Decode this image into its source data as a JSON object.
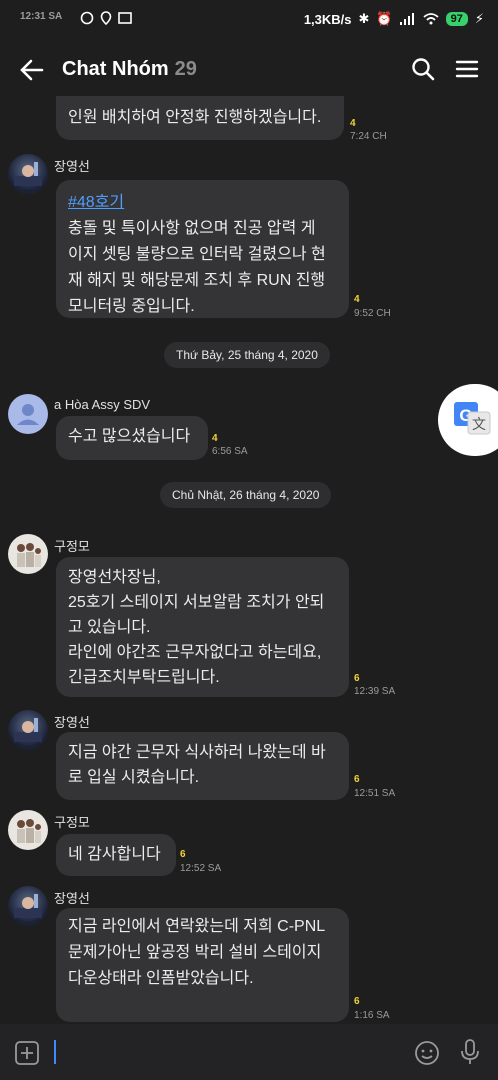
{
  "status_bar": {
    "time": "12:31 SA",
    "network_speed": "1,3KB/s",
    "battery": "97"
  },
  "header": {
    "title": "Chat Nhóm",
    "member_count": "29"
  },
  "messages": [
    {
      "lines": [
        "인원 배치하여 안정화 진행하겠습니다."
      ],
      "read": "4",
      "time": "7:24 CH"
    },
    {
      "sender": "장영선",
      "hashtag": "#48호기",
      "lines": [
        "충돌 및 특이사항 없으며 진공 압력 게",
        "이지 셋팅 불량으로 인터락 걸렸으나 현",
        "재 해지 및 해당문제 조치 후 RUN 진행",
        "모니터링 중입니다."
      ],
      "read": "4",
      "time": "9:52 CH"
    },
    {
      "date": "Thứ Bảy, 25 tháng 4, 2020"
    },
    {
      "sender": "a Hòa Assy SDV",
      "lines": [
        "수고 많으셨습니다"
      ],
      "read": "4",
      "time": "6:56 SA"
    },
    {
      "date": "Chủ Nhật, 26 tháng 4, 2020"
    },
    {
      "sender": "구정모",
      "lines": [
        "장영선차장님,",
        "25호기 스테이지 서보알람 조치가 안되",
        "고 있습니다.",
        "라인에 야간조 근무자없다고 하는데요,",
        "긴급조치부탁드립니다."
      ],
      "read": "6",
      "time": "12:39 SA"
    },
    {
      "sender": "장영선",
      "lines": [
        "지금 야간 근무자 식사하러 나왔는데 바",
        "로 입실 시켰습니다."
      ],
      "read": "6",
      "time": "12:51 SA"
    },
    {
      "sender": "구정모",
      "lines": [
        "네 감사합니다"
      ],
      "read": "6",
      "time": "12:52 SA"
    },
    {
      "sender": "장영선",
      "lines": [
        "지금 라인에서 연락왔는데 저희 C-PNL",
        "문제가아닌 앞공정 박리 설비 스테이지",
        "다운상태라 인폼받았습니다."
      ],
      "read": "6",
      "time": "1:16 SA"
    }
  ],
  "colors": {
    "background": "#1e1e1f",
    "bubble": "#343437",
    "read_count": "#f2d23a",
    "link": "#4f9dfc",
    "accent": "#3d8bff"
  },
  "icons": [
    "back-arrow-icon",
    "search-icon",
    "menu-icon",
    "google-translate-icon",
    "plus-icon",
    "emoji-icon",
    "mic-icon"
  ]
}
